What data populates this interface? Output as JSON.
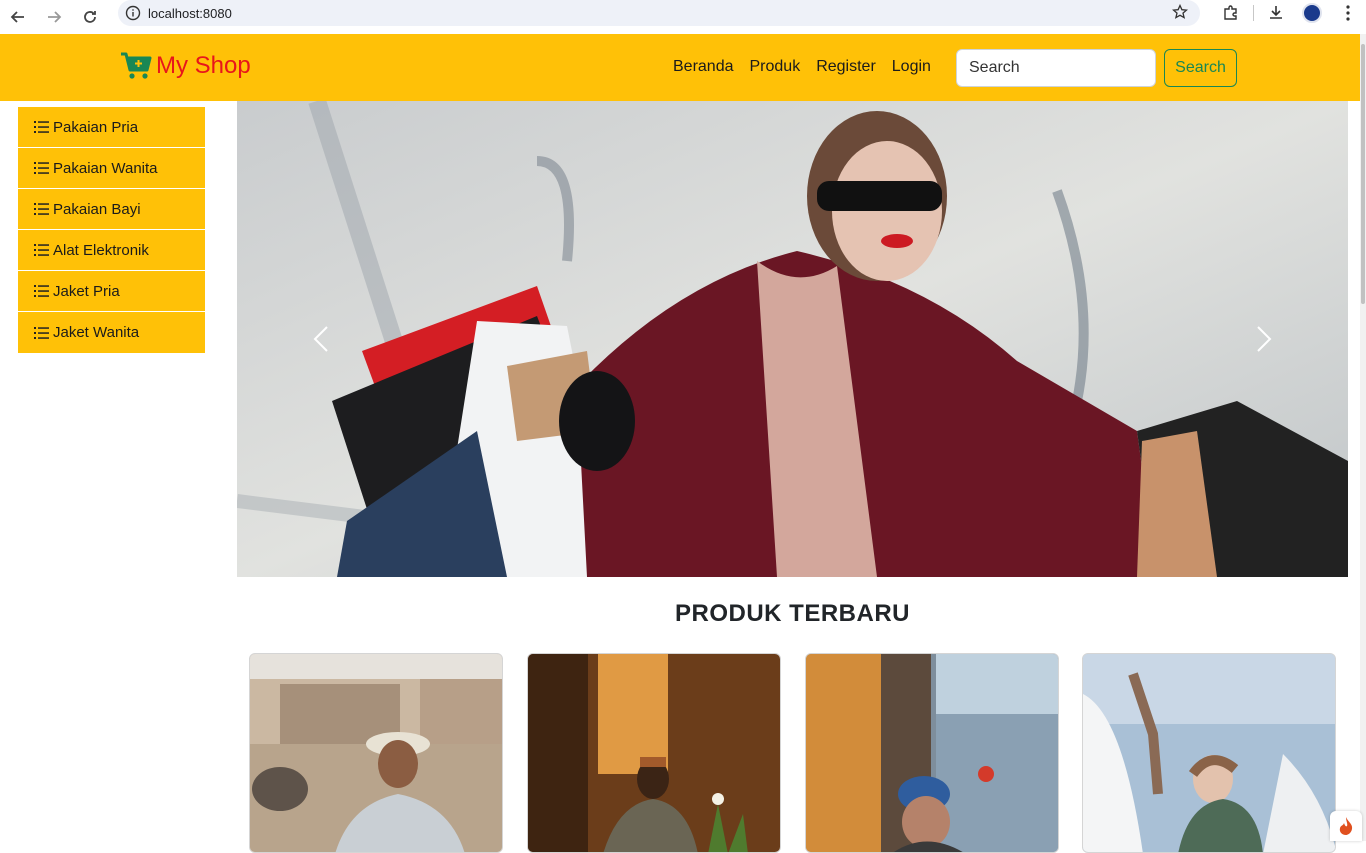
{
  "browser": {
    "url": "localhost:8080"
  },
  "navbar": {
    "brand": "My Shop",
    "links": [
      "Beranda",
      "Produk",
      "Register",
      "Login"
    ],
    "search_placeholder": "Search",
    "search_button": "Search"
  },
  "sidebar": {
    "items": [
      {
        "label": "Pakaian Pria"
      },
      {
        "label": "Pakaian Wanita"
      },
      {
        "label": "Pakaian Bayi"
      },
      {
        "label": "Alat Elektronik"
      },
      {
        "label": "Jaket Pria"
      },
      {
        "label": "Jaket Wanita"
      }
    ]
  },
  "main": {
    "section_title": "PRODUK TERBARU"
  },
  "colors": {
    "navbar_bg": "#ffc107",
    "brand_text": "#e8151b",
    "cart_icon": "#198754",
    "search_button": "#198754"
  },
  "icons": {
    "cart": "shopping-cart-plus-icon",
    "list": "list-icon",
    "prev": "chevron-left-icon",
    "next": "chevron-right-icon"
  }
}
